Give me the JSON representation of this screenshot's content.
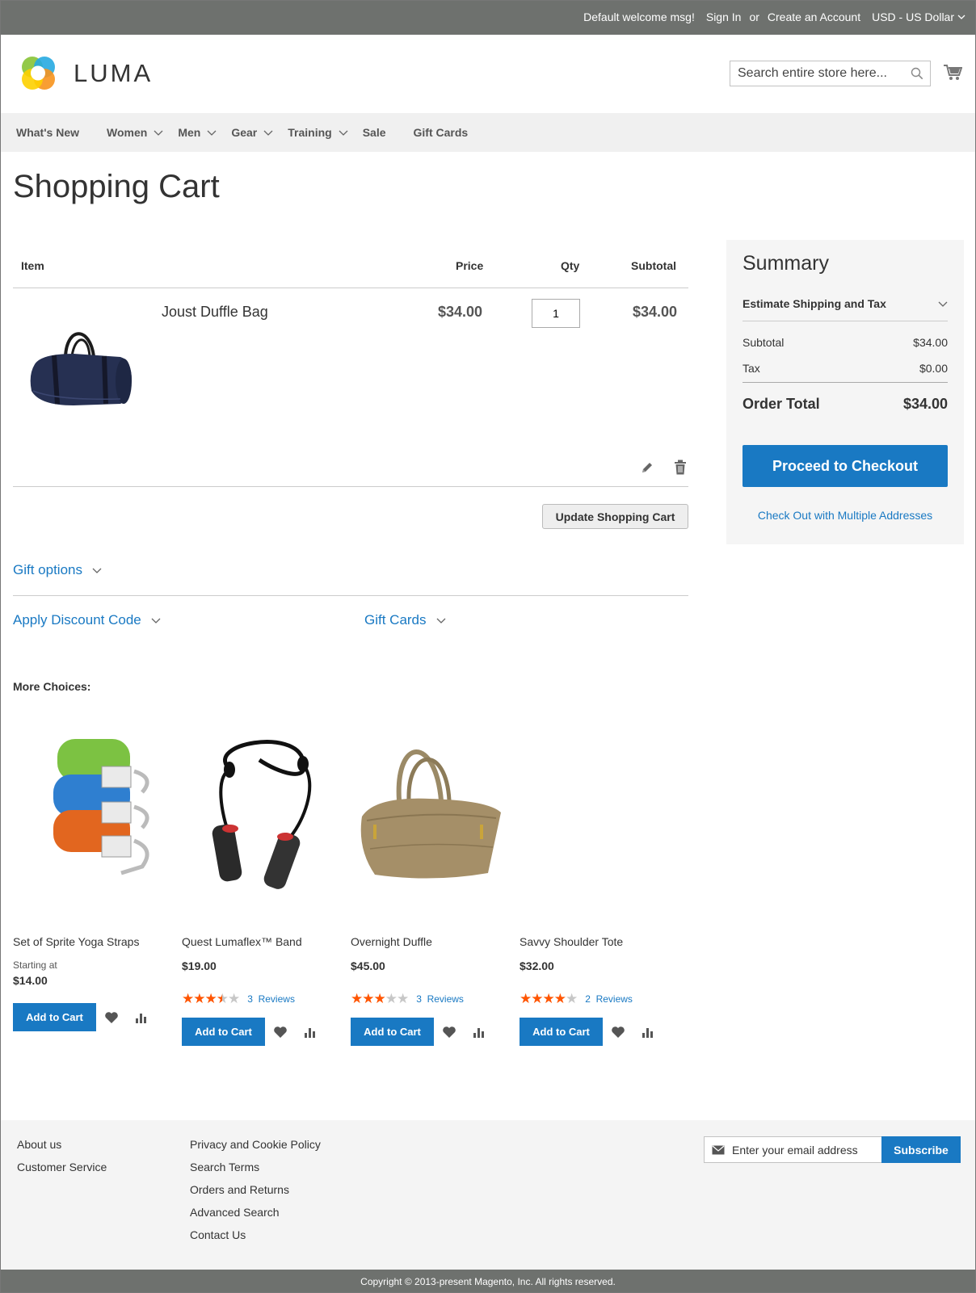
{
  "topbar": {
    "welcome": "Default welcome msg!",
    "sign_in": "Sign In",
    "or": "or",
    "create_account": "Create an Account",
    "currency": "USD - US Dollar"
  },
  "header": {
    "logo_text": "LUMA",
    "search_placeholder": "Search entire store here..."
  },
  "nav": {
    "items": [
      {
        "label": "What's New",
        "dropdown": false
      },
      {
        "label": "Women",
        "dropdown": true
      },
      {
        "label": "Men",
        "dropdown": true
      },
      {
        "label": "Gear",
        "dropdown": true
      },
      {
        "label": "Training",
        "dropdown": true
      },
      {
        "label": "Sale",
        "dropdown": false
      },
      {
        "label": "Gift Cards",
        "dropdown": false
      }
    ]
  },
  "page_title": "Shopping Cart",
  "cart": {
    "headers": {
      "item": "Item",
      "price": "Price",
      "qty": "Qty",
      "subtotal": "Subtotal"
    },
    "items": [
      {
        "name": "Joust Duffle Bag",
        "price": "$34.00",
        "qty": "1",
        "subtotal": "$34.00"
      }
    ],
    "update_label": "Update Shopping Cart",
    "gift_options": "Gift options",
    "discount": "Apply Discount Code",
    "gift_cards": "Gift Cards"
  },
  "summary": {
    "title": "Summary",
    "estimate": "Estimate Shipping and Tax",
    "subtotal_label": "Subtotal",
    "subtotal_value": "$34.00",
    "tax_label": "Tax",
    "tax_value": "$0.00",
    "total_label": "Order Total",
    "total_value": "$34.00",
    "checkout_label": "Proceed to Checkout",
    "multi_label": "Check Out with Multiple Addresses"
  },
  "more_choices": {
    "title": "More Choices:",
    "add_label": "Add to Cart",
    "products": [
      {
        "name": "Set of Sprite Yoga Straps",
        "starting": "Starting at",
        "price": "$14.00",
        "rating": 0,
        "reviews": ""
      },
      {
        "name": "Quest Lumaflex™ Band",
        "starting": "",
        "price": "$19.00",
        "rating": 3.5,
        "reviews_count": "3",
        "reviews": "Reviews"
      },
      {
        "name": "Overnight Duffle",
        "starting": "",
        "price": "$45.00",
        "rating": 3,
        "reviews_count": "3",
        "reviews": "Reviews"
      },
      {
        "name": "Savvy Shoulder Tote",
        "starting": "",
        "price": "$32.00",
        "rating": 4,
        "reviews_count": "2",
        "reviews": "Reviews"
      }
    ]
  },
  "footer": {
    "col1": [
      "About us",
      "Customer Service"
    ],
    "col2": [
      "Privacy and Cookie Policy",
      "Search Terms",
      "Orders and Returns",
      "Advanced Search",
      "Contact Us"
    ],
    "newsletter_placeholder": "Enter your email address",
    "subscribe": "Subscribe",
    "copyright": "Copyright © 2013-present Magento, Inc. All rights reserved."
  },
  "colors": {
    "topbar": "#6e716e",
    "accent": "#1979c3",
    "stars": "#ff5501"
  }
}
